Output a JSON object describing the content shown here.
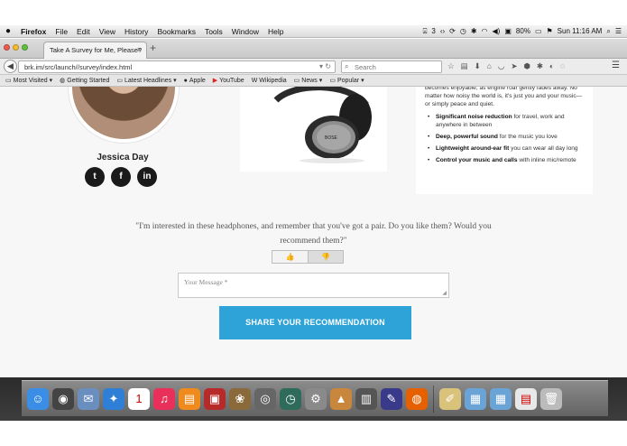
{
  "menubar": {
    "app_name": "Firefox",
    "items": [
      "File",
      "Edit",
      "View",
      "History",
      "Bookmarks",
      "Tools",
      "Window",
      "Help"
    ],
    "status": {
      "adobe_count": "3",
      "battery": "80%",
      "clock": "Sun 11:16 AM"
    }
  },
  "browser": {
    "tab_title": "Take A Survey for Me, Please?",
    "url": "brk.im/src/launch//survey/index.html",
    "search_placeholder": "Search"
  },
  "bookmarks": [
    {
      "label": "Most Visited",
      "icon": "folder-icon"
    },
    {
      "label": "Getting Started",
      "icon": "firefox-icon"
    },
    {
      "label": "Latest Headlines",
      "icon": "rss-icon"
    },
    {
      "label": "Apple",
      "icon": "apple-icon"
    },
    {
      "label": "YouTube",
      "icon": "youtube-icon"
    },
    {
      "label": "Wikipedia",
      "icon": "wikipedia-icon"
    },
    {
      "label": "News",
      "icon": "folder-icon"
    },
    {
      "label": "Popular",
      "icon": "folder-icon"
    }
  ],
  "author": {
    "name": "Jessica Day",
    "social": [
      {
        "icon": "twitter-icon",
        "glyph": "t"
      },
      {
        "icon": "facebook-icon",
        "glyph": "f"
      },
      {
        "icon": "linkedin-icon",
        "glyph": "in"
      }
    ]
  },
  "features": {
    "intro": "becomes enjoyable, as engine roar gently fades away. No matter how noisy the world is, it's just you and your music—or simply peace and quiet.",
    "items": [
      {
        "bold": "Significant noise reduction",
        "rest": " for travel, work and anywhere in between"
      },
      {
        "bold": "Deep, powerful sound",
        "rest": " for the music you love"
      },
      {
        "bold": "Lightweight around-ear fit",
        "rest": " you can wear all day long"
      },
      {
        "bold": "Control your music and calls",
        "rest": " with inline mic/remote"
      }
    ]
  },
  "survey": {
    "quote": "\"I'm interested in these headphones, and remember that you've got a pair. Do you like them? Would you recommend them?\"",
    "thumbs_up_glyph": "👍",
    "thumbs_down_glyph": "👎",
    "message_placeholder": "Your Message *",
    "share_label": "SHARE YOUR RECOMMENDATION"
  },
  "colors": {
    "share_button": "#2ea3d8",
    "social_button": "#1a1a1a"
  },
  "dock": [
    {
      "name": "finder-icon",
      "glyph": "☺",
      "color": "#3a8ee6"
    },
    {
      "name": "dashboard-icon",
      "glyph": "◉",
      "color": "#444444"
    },
    {
      "name": "mail-icon",
      "glyph": "✉",
      "color": "#6a8fbf"
    },
    {
      "name": "safari-icon",
      "glyph": "✦",
      "color": "#2f7fd6"
    },
    {
      "name": "calendar-icon",
      "glyph": "1",
      "color": "#ffffff"
    },
    {
      "name": "itunes-icon",
      "glyph": "♫",
      "color": "#e8305a"
    },
    {
      "name": "ibooks-icon",
      "glyph": "▤",
      "color": "#f08a1c"
    },
    {
      "name": "photo-booth-icon",
      "glyph": "▣",
      "color": "#b72a2a"
    },
    {
      "name": "iphoto-icon",
      "glyph": "❀",
      "color": "#8a6a3a"
    },
    {
      "name": "camera-icon",
      "glyph": "◎",
      "color": "#666666"
    },
    {
      "name": "time-machine-icon",
      "glyph": "◷",
      "color": "#2e6b5a"
    },
    {
      "name": "system-preferences-icon",
      "glyph": "⚙",
      "color": "#8a8a8a"
    },
    {
      "name": "keynote-icon",
      "glyph": "▲",
      "color": "#c9863d"
    },
    {
      "name": "preview-icon",
      "glyph": "▥",
      "color": "#555555"
    },
    {
      "name": "quill-icon",
      "glyph": "✎",
      "color": "#3a3a8a"
    },
    {
      "name": "firefox-icon",
      "glyph": "◍",
      "color": "#e66000"
    },
    {
      "name": "script-editor-icon",
      "glyph": "✐",
      "color": "#d9c27a"
    },
    {
      "name": "applications-folder-icon",
      "glyph": "▦",
      "color": "#6aa3d6"
    },
    {
      "name": "documents-folder-icon",
      "glyph": "▦",
      "color": "#6aa3d6"
    },
    {
      "name": "downloads-stack-icon",
      "glyph": "▤",
      "color": "#e8e8e8"
    },
    {
      "name": "trash-icon",
      "glyph": "🗑",
      "color": "#bbbbbb"
    }
  ]
}
